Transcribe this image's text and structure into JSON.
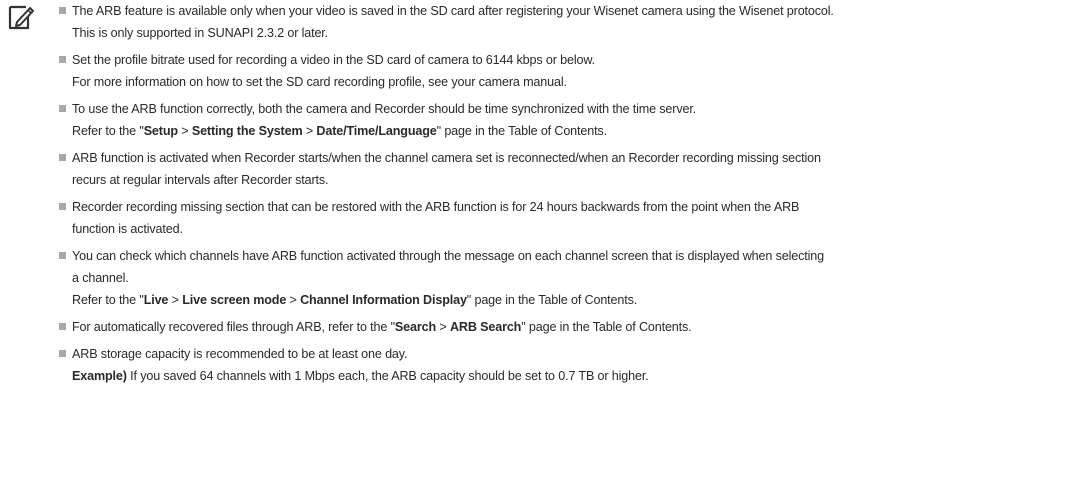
{
  "notes": [
    {
      "lines": [
        "The ARB feature is available only when your video is saved in the SD card after registering your Wisenet camera using the Wisenet protocol.",
        "This is only supported in SUNAPI 2.3.2 or later."
      ]
    },
    {
      "lines": [
        "Set the profile bitrate used for recording a video in the SD card of camera to 6144 kbps or below.",
        "For more information on how to set the SD card recording profile, see your camera manual."
      ]
    },
    {
      "line1": "To use the ARB function correctly, both the camera and Recorder should be time synchronized with the time server.",
      "ref": {
        "prefix": "Refer to the \"",
        "bold1": "Setup",
        "sep1": " > ",
        "bold2": "Setting the System",
        "sep2": " > ",
        "bold3": "Date/Time/Language",
        "suffix": "\" page in the Table of Contents."
      }
    },
    {
      "lines": [
        "ARB function is activated when Recorder starts/when the channel camera set is reconnected/when an Recorder recording missing section",
        "recurs at regular intervals after Recorder starts."
      ]
    },
    {
      "lines": [
        "Recorder recording missing section that can be restored with the ARB function is for 24 hours backwards from the point when the ARB",
        "function is activated."
      ]
    },
    {
      "line1": "You can check which channels have ARB function activated through the message on each channel screen that is displayed when selecting",
      "line2": "a channel.",
      "ref": {
        "prefix": "Refer to the \"",
        "bold1": "Live",
        "sep1": " > ",
        "bold2": "Live screen mode",
        "sep2": " > ",
        "bold3": "Channel Information Display",
        "suffix": "\" page in the Table of Contents."
      }
    },
    {
      "ref": {
        "prefix": "For automatically recovered files through ARB, refer to the \"",
        "bold1": "Search",
        "sep1": " > ",
        "bold2": "ARB Search",
        "suffix": "\" page in the Table of Contents."
      }
    },
    {
      "line1": "ARB storage capacity is recommended to be at least one day.",
      "example_label": "Example)",
      "example_text": " If you saved 64 channels with 1 Mbps each, the ARB capacity should be set to 0.7 TB or higher."
    }
  ],
  "colors": {
    "text": "#2a2a2a",
    "bullet": "#a8a8a8",
    "icon": "#333333"
  },
  "icons": {
    "note": "note-pencil-icon",
    "bullet": "square-bullet-icon"
  }
}
